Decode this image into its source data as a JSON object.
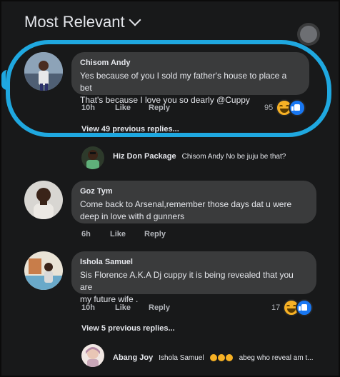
{
  "header": {
    "title": "Most Relevant"
  },
  "comments": [
    {
      "name": "Chisom Andy",
      "text_lines": [
        "Yes because of you I sold my father's house to place a bet",
        "That's because I love you so dearly @Cuppy"
      ],
      "time": "10h",
      "like": "Like",
      "reply": "Reply",
      "reactions": "95",
      "view_replies": "View 49 previous replies..."
    },
    {
      "name": "Goz Tym",
      "text_lines": [
        "Come back to Arsenal,remember those days dat u were",
        "deep in love with d gunners"
      ],
      "time": "6h",
      "like": "Like",
      "reply": "Reply"
    },
    {
      "name": "Ishola Samuel",
      "text_lines": [
        "Sis Florence A.K.A Dj cuppy it is being revealed that you are",
        "my future wife ."
      ],
      "time": "10h",
      "like": "Like",
      "reply": "Reply",
      "reactions": "17",
      "view_replies": "View 5 previous replies..."
    }
  ],
  "replies": [
    {
      "name": "Hiz Don Package",
      "text": "Chisom Andy No be juju be that?"
    },
    {
      "name": "Abang Joy",
      "mention": "Ishola Samuel",
      "text": "abeg who reveal am t..."
    }
  ],
  "colors": {
    "highlight": "#1fa8e0",
    "background": "#18191a",
    "bubble": "#3a3b3c",
    "like_blue": "#1877f2",
    "haha_yellow": "#f7b125"
  }
}
